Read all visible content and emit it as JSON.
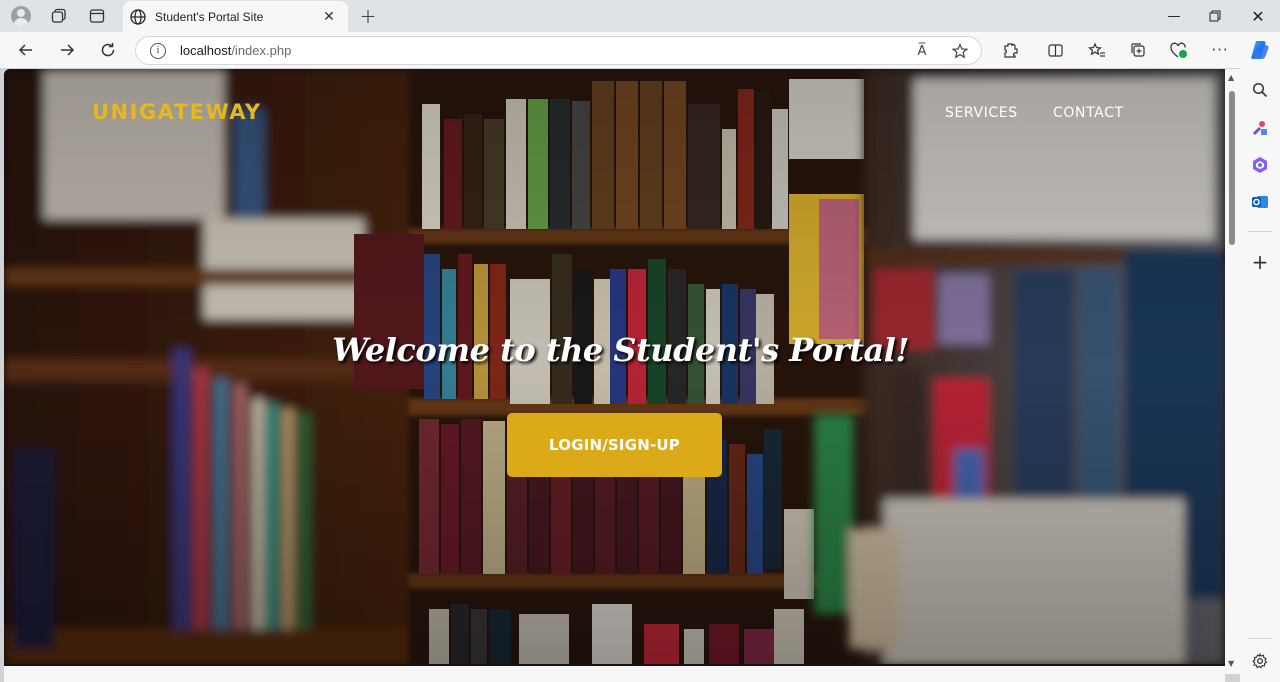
{
  "browser": {
    "tab_title": "Student's Portal Site",
    "address": {
      "host": "localhost",
      "path": "/index.php"
    },
    "icons": [
      "profile-icon",
      "workspaces-icon",
      "tab-actions-icon",
      "globe-icon",
      "close-icon",
      "new-tab-icon",
      "minimize-icon",
      "maximize-icon",
      "window-close-icon",
      "back-icon",
      "forward-icon",
      "refresh-icon",
      "site-info-icon",
      "read-aloud-icon",
      "favorite-star-icon",
      "extensions-icon",
      "split-screen-icon",
      "favorites-icon",
      "collections-icon",
      "browser-essentials-icon",
      "more-icon",
      "copilot-icon",
      "search-icon",
      "tools-icon",
      "office-icon",
      "outlook-icon",
      "add-icon",
      "settings-icon"
    ],
    "read_aloud_label": "A̅"
  },
  "site": {
    "brand": "UNIGATEWAY",
    "nav": {
      "services": "SERVICES",
      "contact": "CONTACT"
    },
    "hero": {
      "heading": "Welcome to the Student's Portal!",
      "cta_label": "LOGIN/SIGN-UP"
    }
  },
  "colors": {
    "brand": "#e5b81c",
    "cta": "#dca918",
    "chrome": "#f7f7f7"
  }
}
